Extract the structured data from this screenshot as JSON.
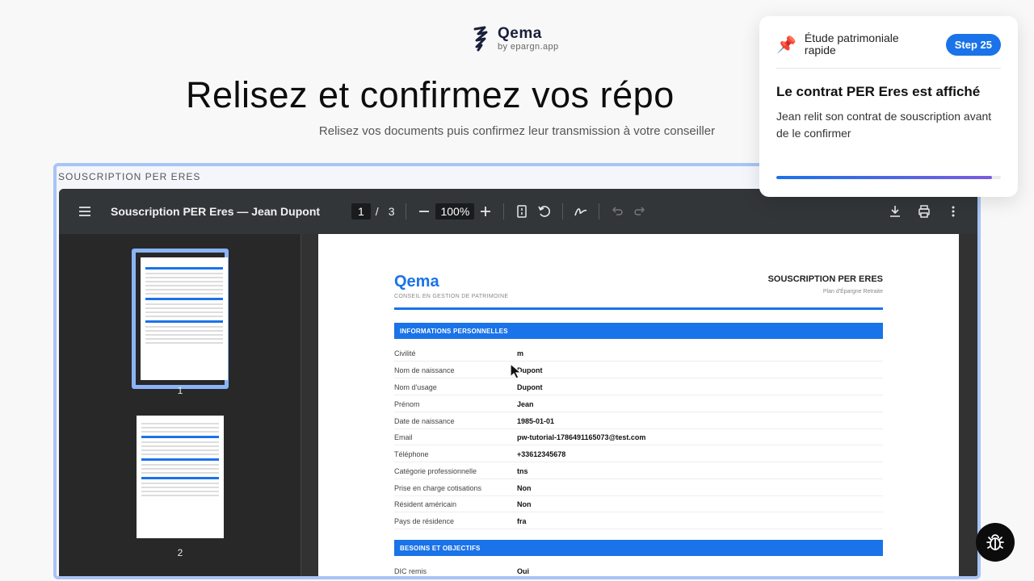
{
  "brand": {
    "name": "Qema",
    "sub": "by epargn.app"
  },
  "hero": {
    "title": "Relisez et confirmez vos répo",
    "subtitle": "Relisez vos documents puis confirmez leur transmission à votre conseiller"
  },
  "document": {
    "label": "SOUSCRIPTION PER ERES",
    "viewer": {
      "title": "Souscription PER Eres — Jean Dupont",
      "current_page": "1",
      "page_sep": "/",
      "total_pages": "3",
      "zoom": "100%",
      "icons": [
        "menu-icon",
        "zoom-out-icon",
        "zoom-in-icon",
        "fit-page-icon",
        "rotate-icon",
        "annotate-icon",
        "undo-icon",
        "redo-icon",
        "download-icon",
        "print-icon",
        "more-icon"
      ]
    },
    "thumbnails": [
      {
        "num": "1",
        "active": true
      },
      {
        "num": "2",
        "active": false
      }
    ],
    "pdf": {
      "logo": "Qema",
      "tagline": "CONSEIL EN GESTION DE PATRIMOINE",
      "doc_title": "SOUSCRIPTION PER ERES",
      "doc_subtitle": "Plan d'Épargne Retraite",
      "section1": "INFORMATIONS PERSONNELLES",
      "fields": [
        {
          "k": "Civilité",
          "v": "m"
        },
        {
          "k": "Nom de naissance",
          "v": "Dupont"
        },
        {
          "k": "Nom d'usage",
          "v": "Dupont"
        },
        {
          "k": "Prénom",
          "v": "Jean"
        },
        {
          "k": "Date de naissance",
          "v": "1985-01-01"
        },
        {
          "k": "Email",
          "v": "pw-tutorial-1786491165073@test.com"
        },
        {
          "k": "Téléphone",
          "v": "+33612345678"
        },
        {
          "k": "Catégorie professionnelle",
          "v": "tns"
        },
        {
          "k": "Prise en charge cotisations",
          "v": "Non"
        },
        {
          "k": "Résident américain",
          "v": "Non"
        },
        {
          "k": "Pays de résidence",
          "v": "fra"
        }
      ],
      "section2": "BESOINS ET OBJECTIFS",
      "fields2": [
        {
          "k": "DIC remis",
          "v": "Oui"
        }
      ]
    }
  },
  "toast": {
    "kicker": "Étude patrimoniale rapide",
    "step": "Step 25",
    "title": "Le contrat PER Eres est affiché",
    "description": "Jean relit son contrat de souscription avant de le confirmer",
    "progress": 0.96
  },
  "colors": {
    "accent": "#1a73e8",
    "frame": "#a8c4f4",
    "toolbar": "#323639"
  }
}
